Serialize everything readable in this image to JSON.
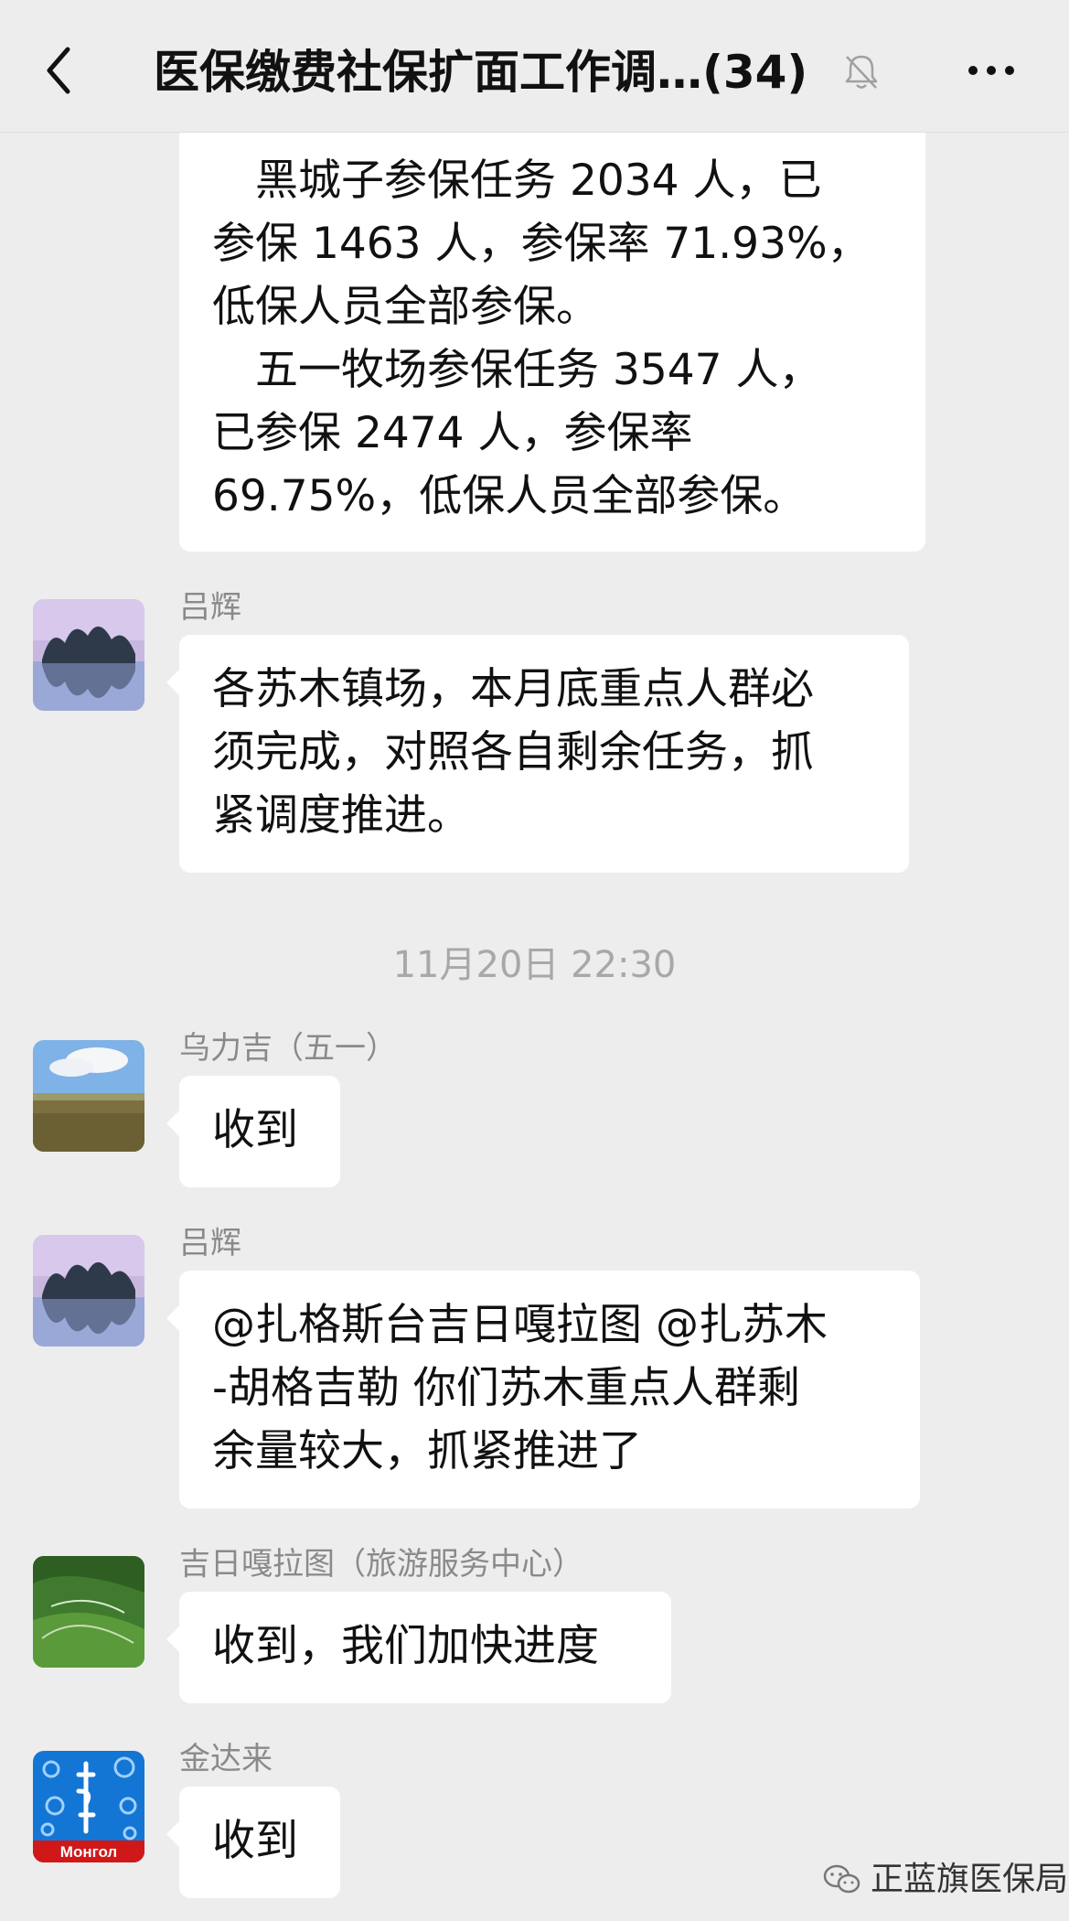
{
  "header": {
    "title": "医保缴费社保扩面工作调…",
    "member_count": "(34)",
    "back_icon": "chevron-left-icon",
    "mute_icon": "bell-muted-icon",
    "more_icon": "more-dots-icon"
  },
  "messages": [
    {
      "lines": [
        "　黑城子参保任务 2034 人，已",
        "参保 1463 人，参保率 71.93%，",
        "低保人员全部参保。",
        "　五一牧场参保任务 3547 人，",
        "已参保 2474 人，参保率",
        "69.75%，低保人员全部参保。"
      ]
    },
    {
      "sender": "吕辉",
      "lines": [
        "各苏木镇场，本月底重点人群必",
        "须完成，对照各自剩余任务，抓",
        "紧调度推进。"
      ]
    },
    {
      "sender": "乌力吉（五一）",
      "lines": [
        "收到"
      ]
    },
    {
      "sender": "吕辉",
      "lines": [
        "@扎格斯台吉日嘎拉图 @扎苏木",
        "-胡格吉勒 你们苏木重点人群剩",
        "余量较大，抓紧推进了"
      ]
    },
    {
      "sender": "吉日嘎拉图（旅游服务中心）",
      "lines": [
        "收到，我们加快进度"
      ]
    },
    {
      "sender": "金达来",
      "lines": [
        "收到"
      ]
    }
  ],
  "timestamp": "11月20日 22:30",
  "avatar4_text": "Монгол",
  "watermark": "正蓝旗医保局"
}
